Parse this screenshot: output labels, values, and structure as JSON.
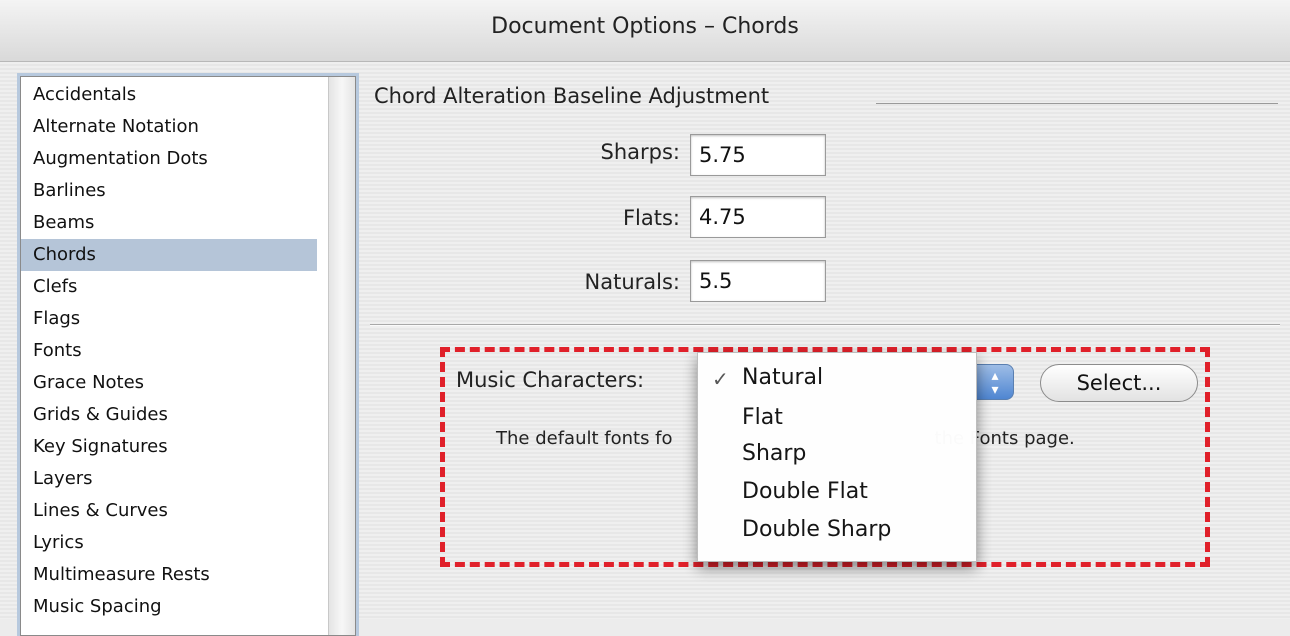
{
  "window": {
    "title": "Document Options – Chords"
  },
  "sidebar": {
    "items": [
      "Accidentals",
      "Alternate Notation",
      "Augmentation Dots",
      "Barlines",
      "Beams",
      "Chords",
      "Clefs",
      "Flags",
      "Fonts",
      "Grace Notes",
      "Grids & Guides",
      "Key Signatures",
      "Layers",
      "Lines & Curves",
      "Lyrics",
      "Multimeasure Rests",
      "Music Spacing"
    ],
    "selected": "Chords"
  },
  "adjustment": {
    "title": "Chord Alteration Baseline Adjustment",
    "sharps_label": "Sharps:",
    "sharps_value": "5.75",
    "flats_label": "Flats:",
    "flats_value": "4.75",
    "naturals_label": "Naturals:",
    "naturals_value": "5.5"
  },
  "music_characters": {
    "label": "Music Characters:",
    "select_button": "Select...",
    "info_left": "The default fonts fo",
    "info_right": "the Fonts page.",
    "options": [
      "Natural",
      "Flat",
      "Sharp",
      "Double Flat",
      "Double Sharp"
    ],
    "selected": "Natural",
    "check_mark": "✓"
  },
  "colors": {
    "selection": "#b5c5d8",
    "highlight_border": "#e0202a",
    "stepper": "#4f86d2"
  }
}
